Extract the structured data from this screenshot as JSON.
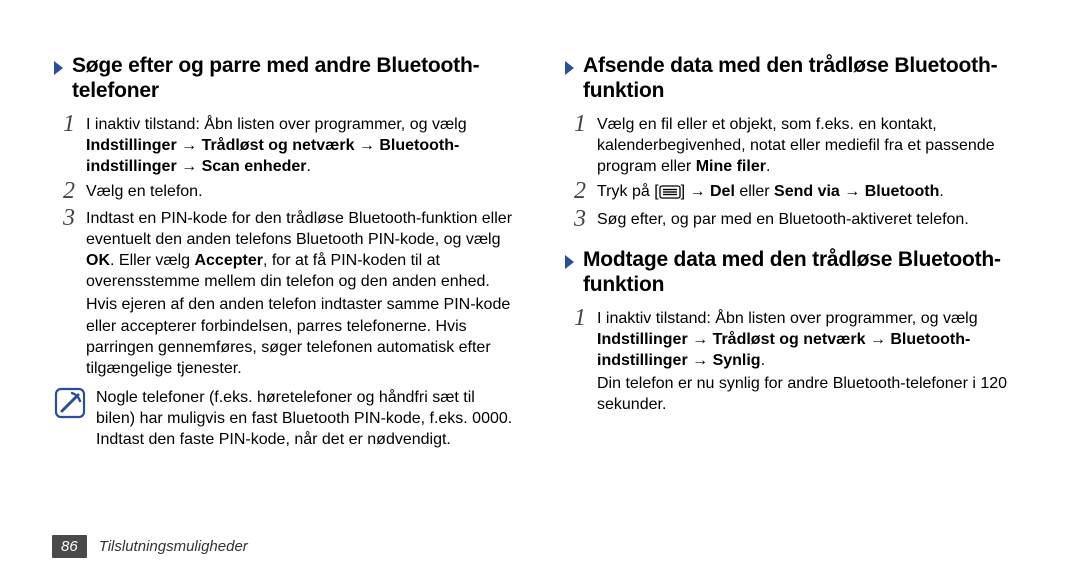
{
  "left": {
    "heading": "Søge efter og parre med andre Bluetooth-telefoner",
    "step1_head": "I inaktiv tilstand: Åbn listen over programmer, og vælg ",
    "step1_bold": "Indstillinger → Trådløst og netværk → Bluetooth-indstillinger → Scan enheder",
    "step1_tail": ".",
    "step2": "Vælg en telefon.",
    "step3_a": "Indtast en PIN-kode for den trådløse Bluetooth-funktion eller eventuelt den anden telefons Bluetooth PIN-kode, og vælg ",
    "step3_ok": "OK",
    "step3_b": ". Eller vælg ",
    "step3_accept": "Accepter",
    "step3_c": ", for at få PIN-koden til at overensstemme mellem din telefon og den anden enhed.",
    "step3_para": "Hvis ejeren af den anden telefon indtaster samme PIN-kode eller accepterer forbindelsen, parres telefonerne. Hvis parringen gennemføres, søger telefonen automatisk efter tilgængelige tjenester.",
    "note": "Nogle telefoner (f.eks. høretelefoner og håndfri sæt til bilen) har muligvis en fast Bluetooth PIN-kode, f.eks. 0000. Indtast den faste PIN-kode, når det er nødvendigt."
  },
  "right": {
    "heading1": "Afsende data med den trådløse Bluetooth-funktion",
    "r1_step1_a": "Vælg en fil eller et objekt, som f.eks. en kontakt, kalenderbegivenhed, notat eller mediefil fra et passende program eller ",
    "r1_step1_bold": "Mine filer",
    "r1_step1_b": ".",
    "r1_step2_a": "Tryk på [",
    "r1_step2_b": "] → ",
    "r1_step2_del": "Del",
    "r1_step2_c": " eller ",
    "r1_step2_send": "Send via",
    "r1_step2_d": " → ",
    "r1_step2_bt": "Bluetooth",
    "r1_step2_e": ".",
    "r1_step3": "Søg efter, og par med en Bluetooth-aktiveret telefon.",
    "heading2": "Modtage data med den trådløse Bluetooth-funktion",
    "r2_step1_a": "I inaktiv tilstand: Åbn listen over programmer, og vælg ",
    "r2_step1_bold": "Indstillinger → Trådløst og netværk → Bluetooth-indstillinger → Synlig",
    "r2_step1_b": ".",
    "r2_para": "Din telefon er nu synlig for andre Bluetooth-telefoner i 120 sekunder."
  },
  "footer": {
    "page": "86",
    "section": "Tilslutningsmuligheder"
  }
}
